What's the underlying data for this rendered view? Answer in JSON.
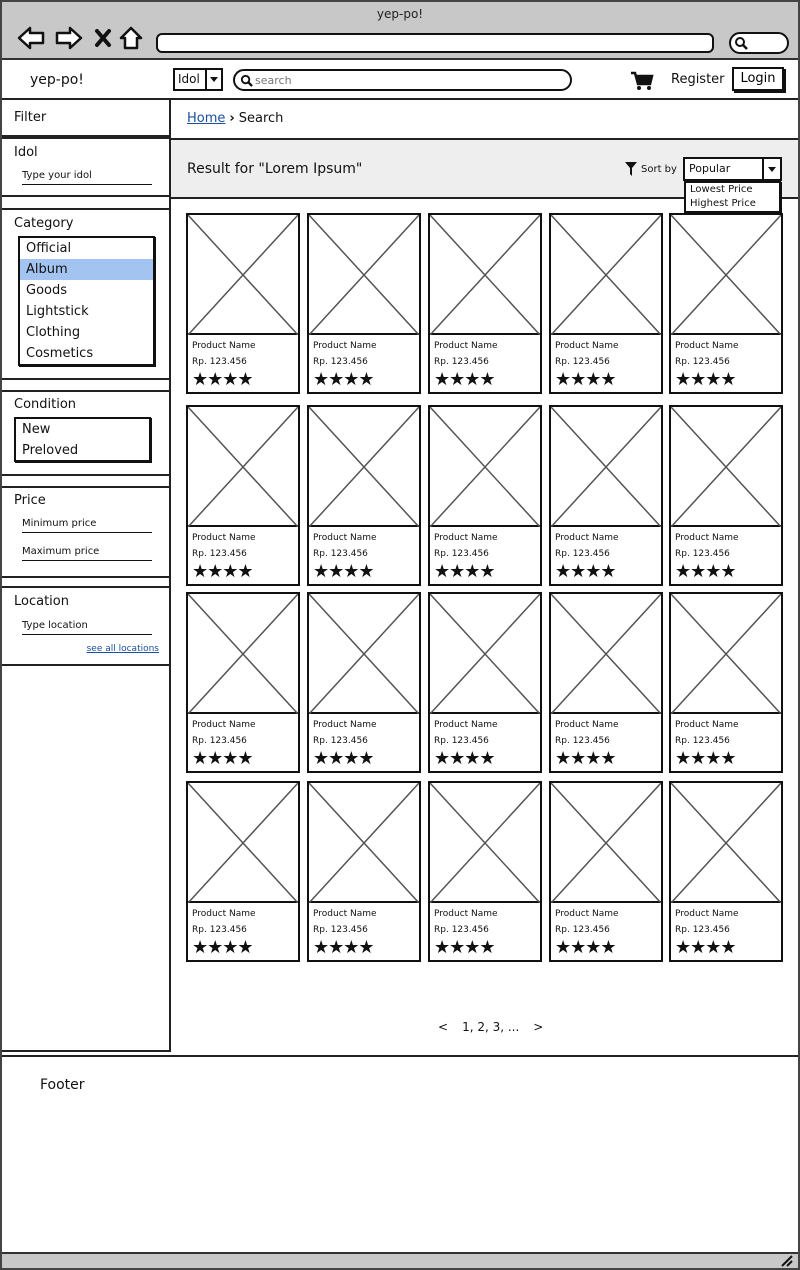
{
  "window": {
    "title": "yep-po!"
  },
  "header": {
    "logo": "yep-po!",
    "idol_select": "Idol",
    "search_placeholder": "search",
    "register": "Register",
    "login": "Login"
  },
  "sidebar": {
    "filter_title": "Filter",
    "idol": {
      "title": "Idol",
      "placeholder": "Type your idol"
    },
    "category": {
      "title": "Category",
      "options": [
        "Official",
        "Album",
        "Goods",
        "Lightstick",
        "Clothing",
        "Cosmetics"
      ],
      "selected": "Album"
    },
    "condition": {
      "title": "Condition",
      "options": [
        "New",
        "Preloved"
      ]
    },
    "price": {
      "title": "Price",
      "min_placeholder": "Minimum price",
      "max_placeholder": "Maximum price"
    },
    "location": {
      "title": "Location",
      "placeholder": "Type location",
      "see_all": "see all locations"
    }
  },
  "breadcrumb": {
    "home": "Home",
    "current": "Search"
  },
  "results": {
    "title": "Result for \"Lorem Ipsum\"",
    "sort_label": "Sort by",
    "sort_selected": "Popular",
    "sort_options": [
      "Lowest Price",
      "Highest Price"
    ]
  },
  "product": {
    "name": "Product Name",
    "price": "Rp. 123.456",
    "rating": 4
  },
  "grid": {
    "rows": 4,
    "cols": 5
  },
  "pagination": {
    "prev": "<",
    "pages": "1, 2, 3, ...",
    "next": ">"
  },
  "footer": {
    "label": "Footer"
  }
}
